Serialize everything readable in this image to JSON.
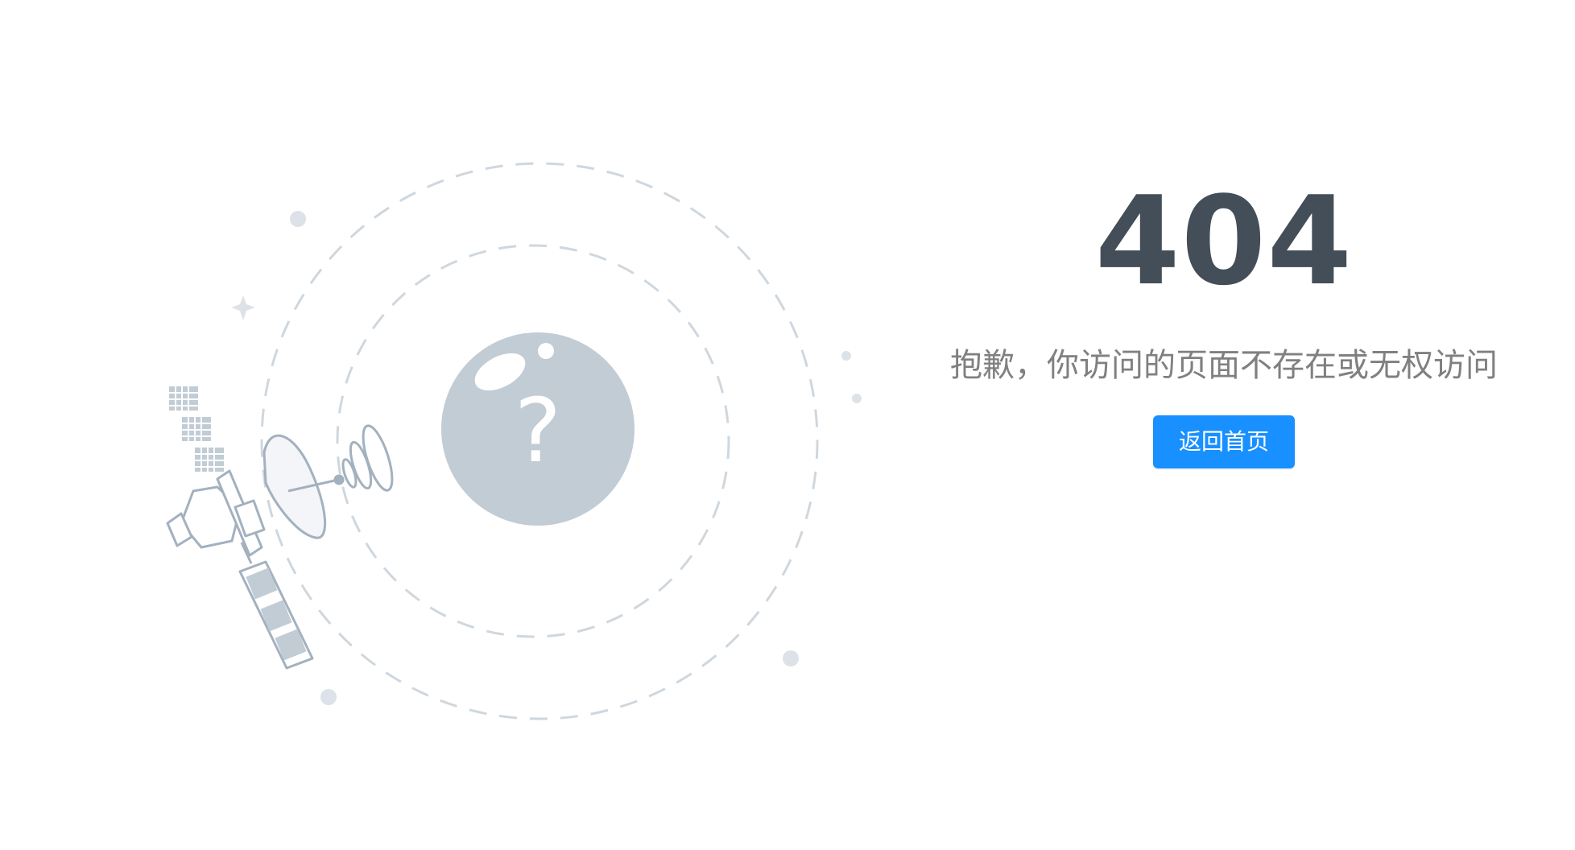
{
  "error": {
    "code": "404",
    "message": "抱歉，你访问的页面不存在或无权访问",
    "back_button_label": "返回首页"
  },
  "illustration": {
    "icon": "satellite-question-illustration",
    "sphere_glyph": "?"
  },
  "colors": {
    "code": "#434e59",
    "message": "#808080",
    "button": "#1890ff",
    "illustration_line": "#a3b1bf",
    "sphere": "#c2ccd5"
  }
}
